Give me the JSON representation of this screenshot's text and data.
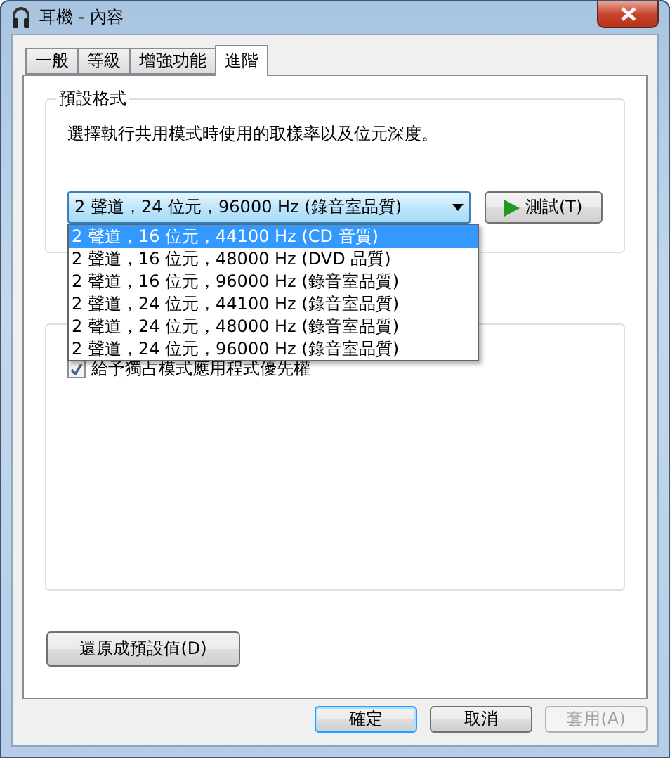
{
  "window": {
    "title": "耳機 - 內容"
  },
  "tabs": [
    {
      "label": "一般",
      "selected": false
    },
    {
      "label": "等級",
      "selected": false
    },
    {
      "label": "增強功能",
      "selected": false
    },
    {
      "label": "進階",
      "selected": true
    }
  ],
  "default_format": {
    "title": "預設格式",
    "description": "選擇執行共用模式時使用的取樣率以及位元深度。",
    "combo": {
      "value": "2 聲道，24 位元，96000 Hz (錄音室品質)",
      "expanded": true,
      "options": [
        {
          "label": "2 聲道，16 位元，44100 Hz (CD 音質)",
          "highlighted": true
        },
        {
          "label": "2 聲道，16 位元，48000 Hz (DVD 品質)",
          "highlighted": false
        },
        {
          "label": "2 聲道，16 位元，96000 Hz (錄音室品質)",
          "highlighted": false
        },
        {
          "label": "2 聲道，24 位元，44100 Hz (錄音室品質)",
          "highlighted": false
        },
        {
          "label": "2 聲道，24 位元，48000 Hz (錄音室品質)",
          "highlighted": false
        },
        {
          "label": "2 聲道，24 位元，96000 Hz (錄音室品質)",
          "highlighted": false
        }
      ]
    },
    "test_button": "測試(T)"
  },
  "exclusive_mode": {
    "checkbox": {
      "label": "給予獨占模式應用程式優先權",
      "checked": true
    }
  },
  "restore_button": "還原成預設值(D)",
  "buttons": [
    {
      "label": "確定",
      "kind": "default",
      "disabled": false
    },
    {
      "label": "取消",
      "kind": "normal",
      "disabled": false
    },
    {
      "label": "套用(A)",
      "kind": "normal",
      "disabled": true
    }
  ]
}
